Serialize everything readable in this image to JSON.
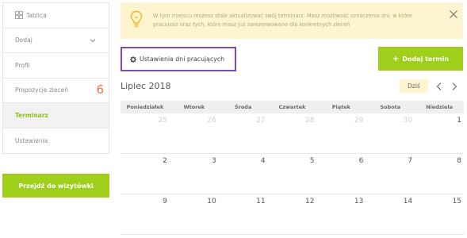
{
  "sidebar": {
    "items": [
      {
        "label": "Tablica"
      },
      {
        "label": "Dodaj"
      },
      {
        "label": "Profil"
      },
      {
        "label": "Propozycje zleceń",
        "badge": "6"
      },
      {
        "label": "Terminarz"
      },
      {
        "label": "Ustawienia"
      }
    ],
    "cta_label": "Przejdź do wizytówki"
  },
  "alert": {
    "message": "W tym miejscu możesz stale aktualizować swój terminarz. Masz możliwość oznaczenia dni, w które pracujesz oraz tych, które masz już zarezerwowane dla konkretnych zleceń"
  },
  "toolbar": {
    "settings_label": "Ustawienia dni pracujących",
    "add_label": "Dodaj termin"
  },
  "calendar": {
    "month_label": "Lipiec 2018",
    "today_label": "Dziś",
    "weekdays": [
      "Poniedziałek",
      "Wtorek",
      "Środa",
      "Czwartek",
      "Piątek",
      "Sobota",
      "Niedziela"
    ],
    "weeks": [
      [
        "25",
        "26",
        "27",
        "28",
        "29",
        "30",
        "1"
      ],
      [
        "2",
        "3",
        "4",
        "5",
        "6",
        "7",
        "8"
      ],
      [
        "9",
        "10",
        "11",
        "12",
        "13",
        "14",
        "15"
      ]
    ]
  },
  "colors": {
    "accent_green": "#9fcf1a",
    "alert_bg": "#fdf4d0",
    "highlight_border": "#7b4bb0",
    "badge": "#f0734a"
  }
}
